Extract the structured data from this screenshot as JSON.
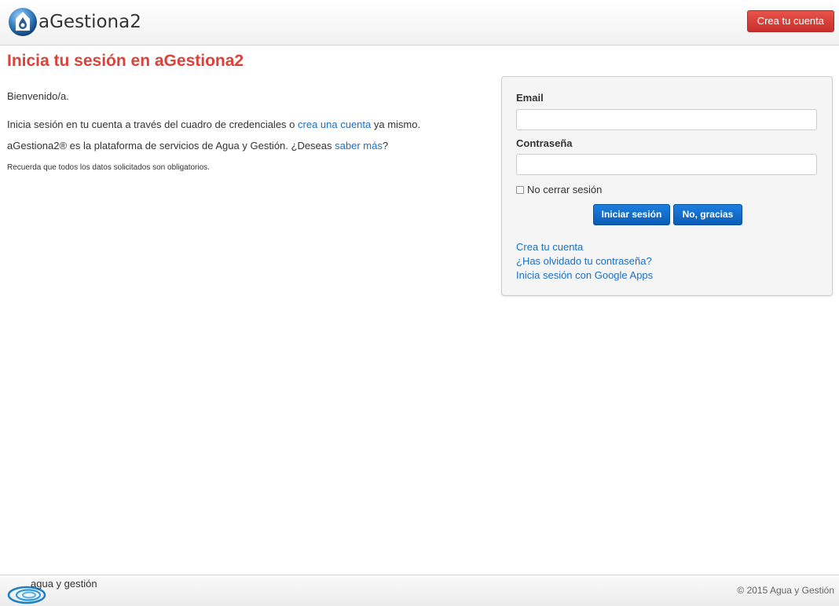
{
  "header": {
    "brand": "aGestiona2",
    "create_account_label": "Crea tu cuenta"
  },
  "main": {
    "title": "Inicia tu sesión en aGestiona2",
    "welcome": "Bienvenido/a.",
    "login_text_before": "Inicia sesión en tu cuenta a través del cuadro de credenciales o ",
    "login_text_link": "crea una cuenta",
    "login_text_after": " ya mismo.",
    "platform_text_before": "aGestiona2® es la plataforma de servicios de Agua y Gestión. ¿Deseas ",
    "platform_text_link": "saber más",
    "platform_text_after": "?",
    "required_note": "Recuerda que todos los datos solicitados son obligatorios."
  },
  "login": {
    "email_label": "Email",
    "email_value": "",
    "password_label": "Contraseña",
    "password_value": "",
    "remember_label": "No cerrar sesión",
    "remember_checked": false,
    "submit_label": "Iniciar sesión",
    "cancel_label": "No, gracias",
    "links": {
      "create": "Crea tu cuenta",
      "forgot": "¿Has olvidado tu contraseña?",
      "google": "Inicia sesión con Google Apps"
    }
  },
  "footer": {
    "brand": "agua y gestión",
    "copyright": "© 2015 Agua y Gestión"
  },
  "colors": {
    "accent_red": "#d9433b",
    "button_blue": "#0b5cb6",
    "link_blue": "#1a6fc4"
  }
}
